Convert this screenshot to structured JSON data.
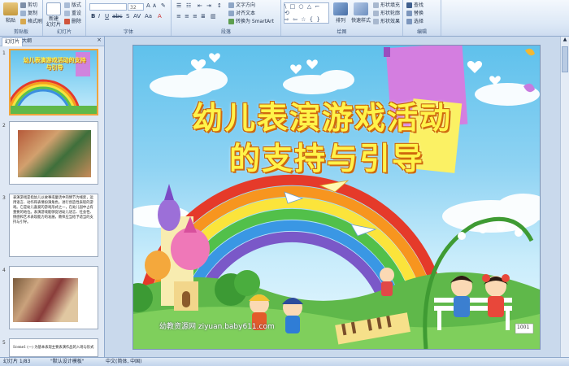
{
  "ribbon": {
    "clipboard": {
      "paste": "粘贴",
      "cut": "剪切",
      "copy": "复制",
      "format_painter": "格式刷",
      "label": "剪贴板"
    },
    "slides": {
      "new_slide": "新建\n幻灯片",
      "layout": "版式",
      "reset": "重设",
      "delete": "删除",
      "label": "幻灯片"
    },
    "font": {
      "font_name": "",
      "font_size": "32",
      "label": "字体"
    },
    "paragraph": {
      "text_direction": "文字方向",
      "align_text": "对齐文本",
      "smartart": "转换为 SmartArt",
      "label": "段落"
    },
    "drawing": {
      "arrange": "排列",
      "quick_styles": "快速样式",
      "shape_fill": "形状填充",
      "shape_outline": "形状轮廓",
      "shape_effects": "形状效果",
      "label": "绘图"
    },
    "editing": {
      "find": "查找",
      "replace": "替换",
      "select": "选择",
      "label": "编辑"
    }
  },
  "panel": {
    "tabs": [
      "幻灯片",
      "大纲"
    ],
    "slide_numbers": [
      "1",
      "2",
      "3",
      "4",
      "5"
    ],
    "slide1_title": "幼儿表演游戏活动的支持与引导",
    "slide3_text": "表演游戏是指幼儿以故事或童话中的情节为线索，运用语言、动作和表情扮演角色，进行创造性表现的游戏。它是幼儿喜爱的游戏形式之一，在幼儿园中占有重要的地位。表演游戏能够促进幼儿语言、社会性、情感和艺术表现能力的发展，教师应当给予适当的支持与引导。",
    "slide5_text": "Scene1 (一) 为基本表现主要表演作品的入场与形式"
  },
  "slide": {
    "title_line1": "幼儿表演游戏活动",
    "title_line2": "的支持与引导",
    "watermark": "幼教资源网 ziyuan.baby611.com",
    "bench_sign": "1001"
  },
  "status": {
    "slide_counter": "幻灯片 1/83",
    "theme": "\"默认设计模板\"",
    "language": "中文(简体, 中国)"
  }
}
